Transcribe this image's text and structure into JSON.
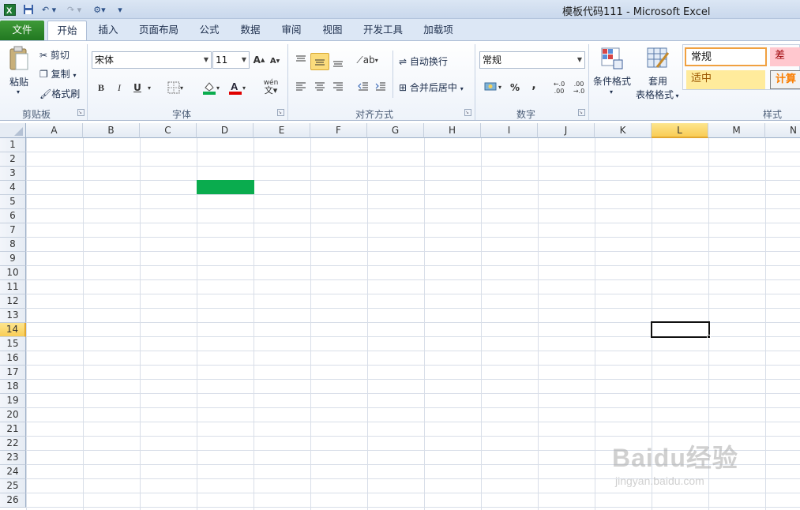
{
  "window": {
    "title": "模板代码111 - Microsoft Excel"
  },
  "tabs": [
    "文件",
    "开始",
    "插入",
    "页面布局",
    "公式",
    "数据",
    "审阅",
    "视图",
    "开发工具",
    "加载项"
  ],
  "clipboard": {
    "paste": "粘贴",
    "cut": "剪切",
    "copy": "复制",
    "format_painter": "格式刷",
    "label": "剪贴板"
  },
  "font": {
    "name": "宋体",
    "size": "11",
    "bold": "B",
    "italic": "I",
    "underline": "U",
    "label": "字体",
    "phonetic": "wén"
  },
  "alignment": {
    "wrap": "自动换行",
    "merge": "合并后居中",
    "label": "对齐方式"
  },
  "number": {
    "format": "常规",
    "percent": "%",
    "comma": ",",
    "inc_decimal": "+.0 .00",
    "dec_decimal": ".00 →.0",
    "label": "数字"
  },
  "styles": {
    "conditional": "条件格式",
    "table_fmt_1": "套用",
    "table_fmt_2": "表格格式",
    "normal": "常规",
    "bad": "差",
    "neutral": "适中",
    "calc": "计算",
    "label": "样式"
  },
  "grid": {
    "columns": [
      "A",
      "B",
      "C",
      "D",
      "E",
      "F",
      "G",
      "H",
      "I",
      "J",
      "K",
      "L",
      "M",
      "N"
    ],
    "rows": [
      "1",
      "2",
      "3",
      "4",
      "5",
      "6",
      "7",
      "8",
      "9",
      "10",
      "11",
      "12",
      "13",
      "14",
      "15",
      "16",
      "17",
      "18",
      "19",
      "20",
      "21",
      "22",
      "23",
      "24",
      "25",
      "26"
    ],
    "selected_column": "L",
    "selected_row": "14",
    "active_cell": "L14",
    "filled_cell": "D4",
    "fill_color": "#0aac4e"
  },
  "watermark": {
    "main": "Baidu经验",
    "sub": "jingyan.baidu.com"
  }
}
